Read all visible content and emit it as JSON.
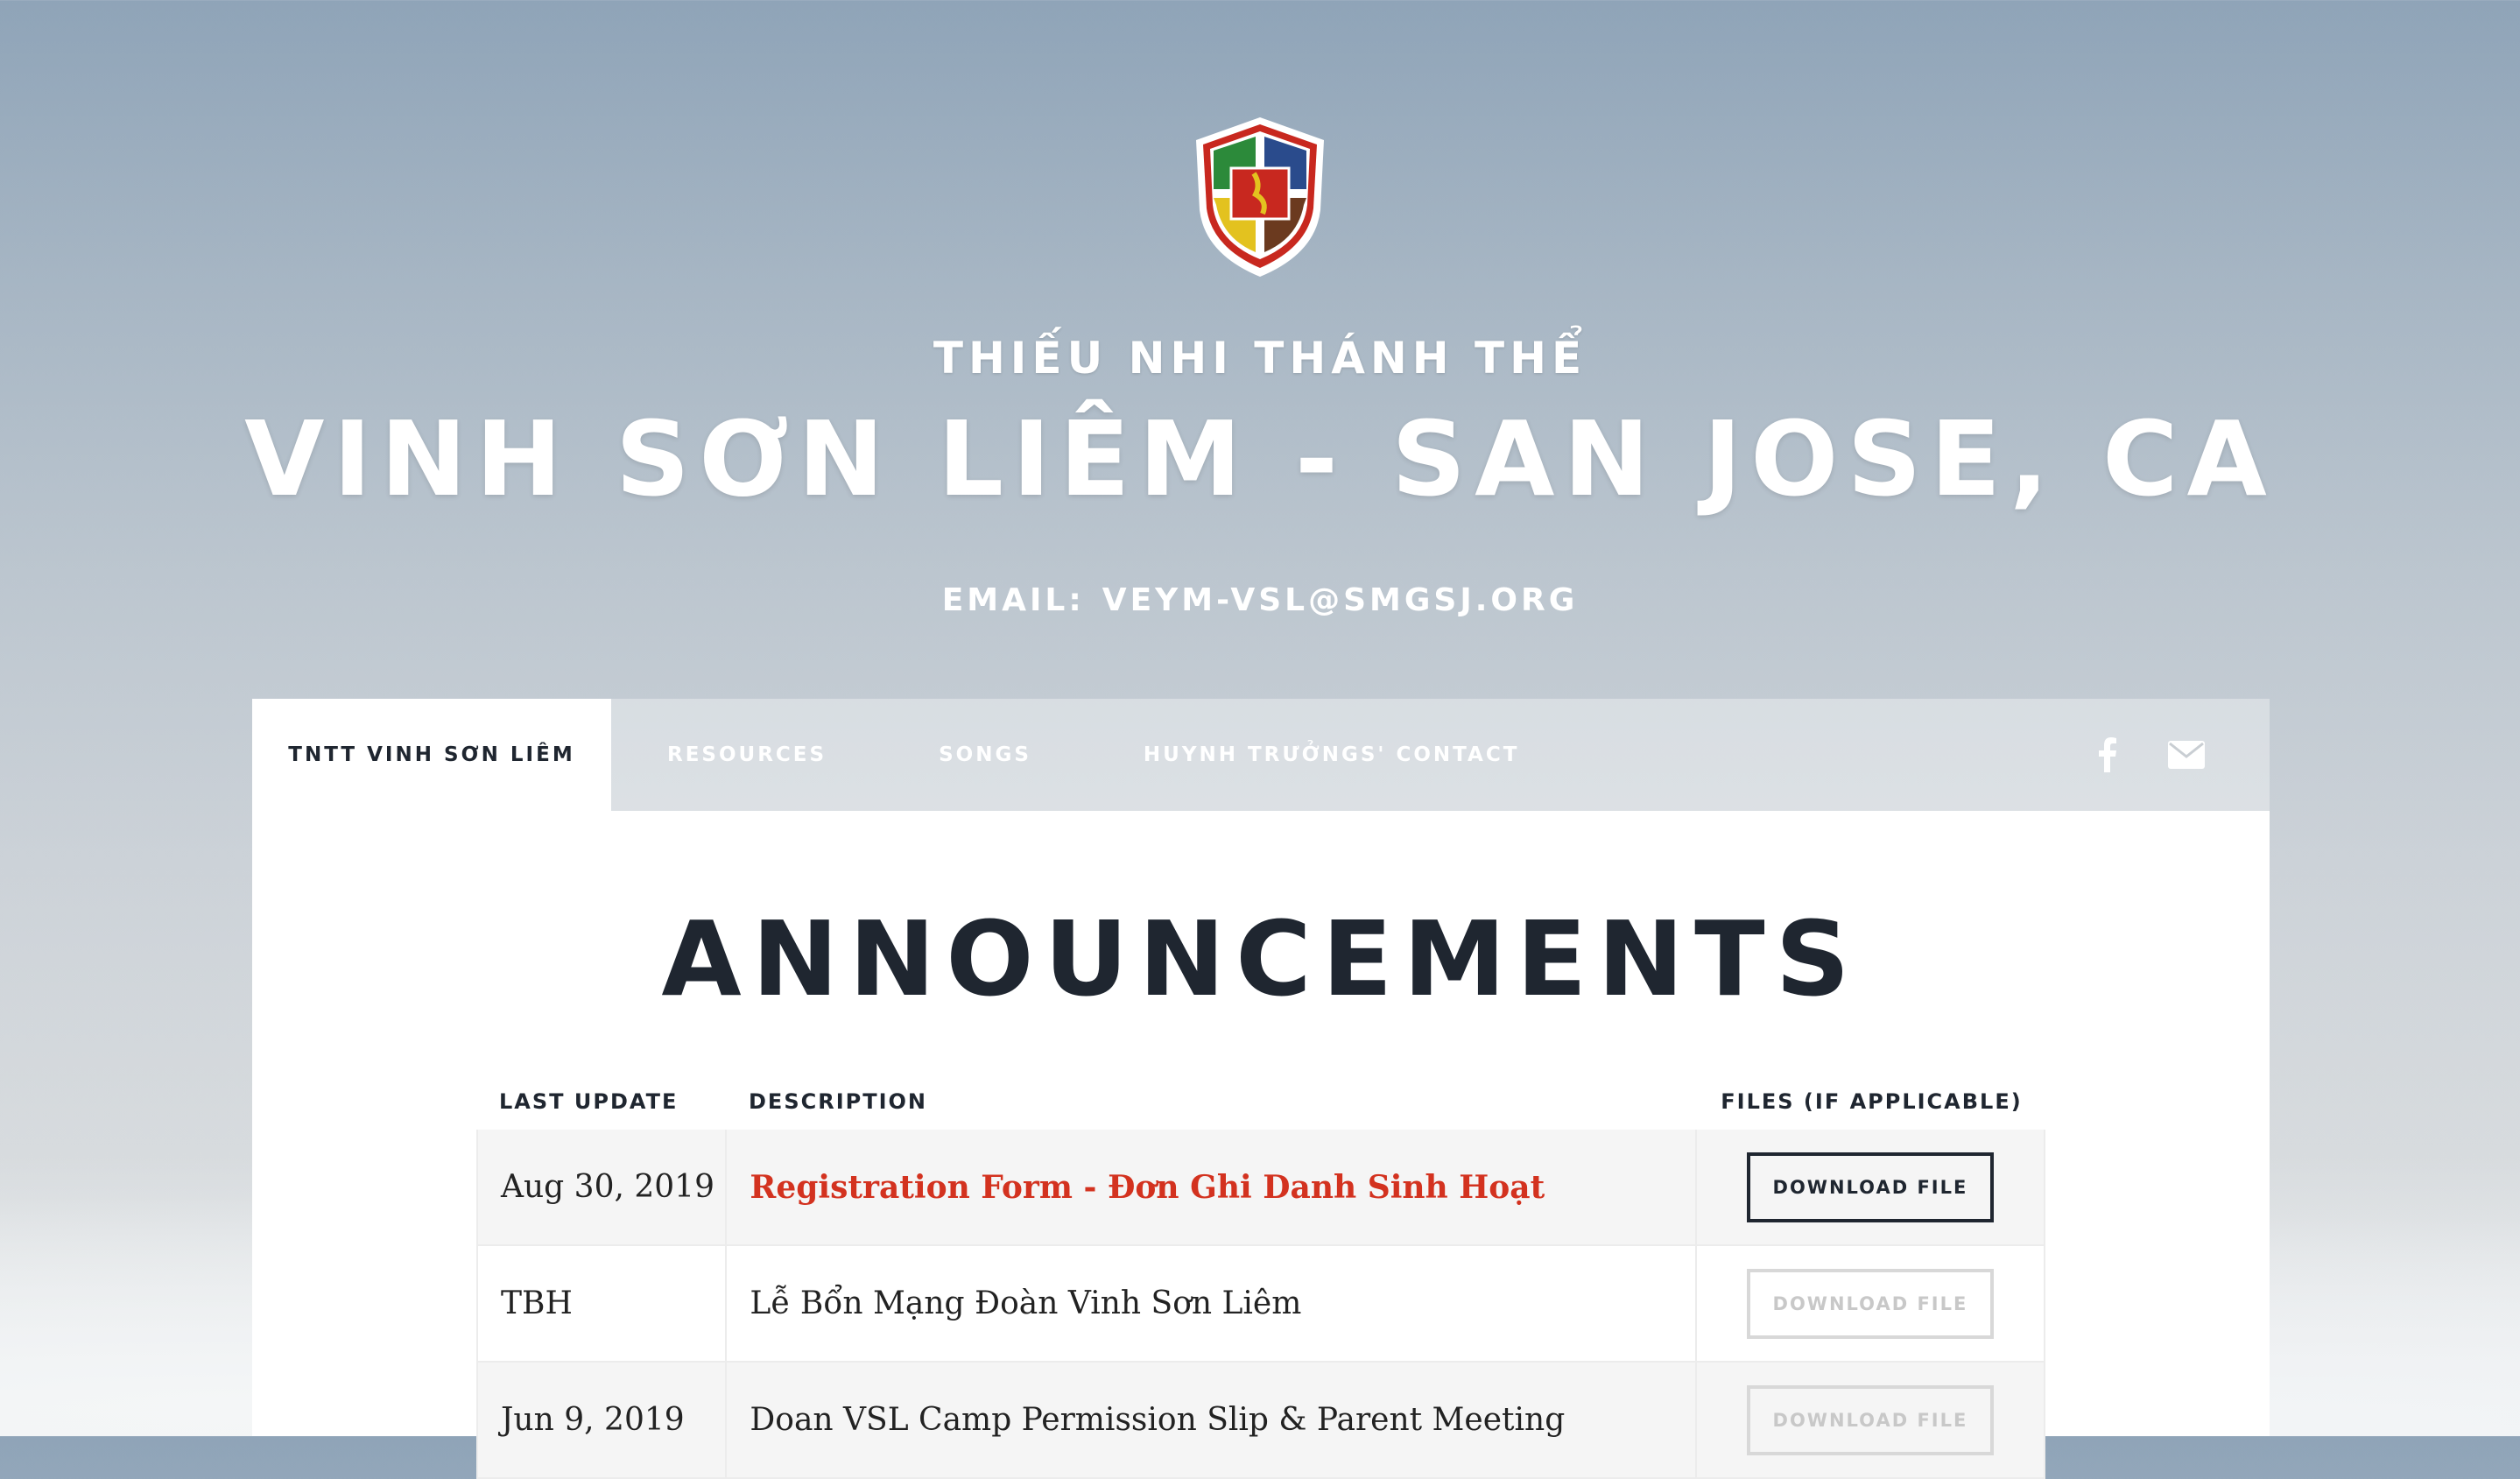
{
  "hero": {
    "subtitle": "THIẾU NHI THÁNH THỂ",
    "title": "VINH SƠN LIÊM - SAN JOSE, CA",
    "email_label": "EMAIL:",
    "email_value": "VEYM-VSL@SMGSJ.ORG"
  },
  "nav": {
    "tabs": [
      {
        "label": "TNTT VINH SƠN LIÊM",
        "active": true
      },
      {
        "label": "RESOURCES",
        "active": false
      },
      {
        "label": "SONGS",
        "active": false
      },
      {
        "label": "HUYNH TRƯỞNGS' CONTACT",
        "active": false
      }
    ],
    "icons": [
      "facebook-icon",
      "envelope-icon"
    ]
  },
  "main": {
    "heading": "ANNOUNCEMENTS",
    "columns": {
      "date": "LAST UPDATE",
      "description": "DESCRIPTION",
      "files": "FILES (IF APPLICABLE)"
    },
    "rows": [
      {
        "date": "Aug 30, 2019",
        "description": "Registration Form - Đơn Ghi Danh Sinh Hoạt",
        "button": "DOWNLOAD FILE",
        "link": true,
        "file_available": true
      },
      {
        "date": "TBH",
        "description": "Lễ Bổn Mạng Đoàn Vinh Sơn Liêm",
        "button": "DOWNLOAD FILE",
        "link": false,
        "file_available": false
      },
      {
        "date": "Jun 9, 2019",
        "description": "Doan VSL Camp Permission Slip & Parent Meeting",
        "button": "DOWNLOAD FILE",
        "link": false,
        "file_available": false
      }
    ]
  },
  "colors": {
    "accent_link": "#d3321f",
    "dark_text": "#1f2630"
  }
}
